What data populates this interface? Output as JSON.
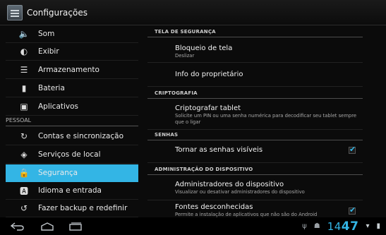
{
  "app": {
    "title": "Configurações",
    "icon": "settings-app-icon"
  },
  "sidebar": {
    "items": [
      {
        "icon": "volume-icon",
        "label": "Som"
      },
      {
        "icon": "brightness-icon",
        "label": "Exibir"
      },
      {
        "icon": "storage-icon",
        "label": "Armazenamento"
      },
      {
        "icon": "battery-icon",
        "label": "Bateria"
      },
      {
        "icon": "apps-icon",
        "label": "Aplicativos"
      }
    ],
    "personal_header": "PESSOAL",
    "personal_items": [
      {
        "icon": "sync-icon",
        "label": "Contas e sincronização"
      },
      {
        "icon": "location-icon",
        "label": "Serviços de local"
      },
      {
        "icon": "lock-icon",
        "label": "Segurança",
        "selected": true
      },
      {
        "icon": "language-icon",
        "label": "Idioma e entrada"
      },
      {
        "icon": "backup-icon",
        "label": "Fazer backup e redefinir"
      }
    ]
  },
  "panel": {
    "screen_security": {
      "header": "TELA DE SEGURANÇA",
      "lock": {
        "title": "Bloqueio de tela",
        "subtitle": "Deslizar"
      },
      "owner": {
        "title": "Info do proprietário"
      }
    },
    "crypto": {
      "header": "CRIPTOGRAFIA",
      "encrypt": {
        "title": "Criptografar tablet",
        "subtitle": "Solicite um PIN ou uma senha numérica para decodificar seu tablet sempre que o ligar"
      }
    },
    "passwords": {
      "header": "SENHAS",
      "visible": {
        "title": "Tornar as senhas visíveis",
        "checked": true
      }
    },
    "admin": {
      "header": "ADMINISTRAÇÃO DO DISPOSITIVO",
      "admins": {
        "title": "Administradores do dispositivo",
        "subtitle": "Visualizar ou desativar administradores do dispositivo"
      },
      "unknown": {
        "title": "Fontes desconhecidas",
        "subtitle": "Permite a instalação de aplicativos que não são do Android",
        "checked": true
      }
    }
  },
  "navbar": {
    "buttons": [
      "back-icon",
      "home-icon",
      "recent-apps-icon"
    ]
  },
  "status": {
    "time_hours": "14",
    "time_minutes": "47",
    "accent": "#33b5e5"
  }
}
